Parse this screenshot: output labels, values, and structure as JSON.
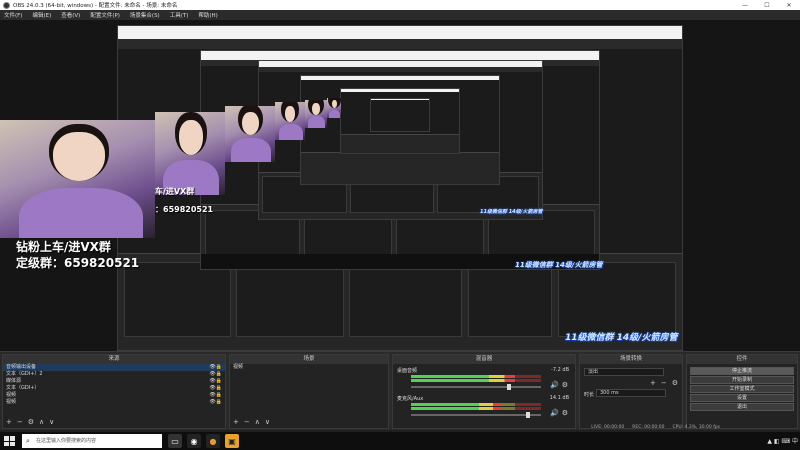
{
  "window": {
    "title": "OBS 24.0.3 (64-bit, windows) - 配置文件: 未命名 - 场景: 未命名",
    "minimize": "—",
    "maximize": "☐",
    "close": "✕"
  },
  "menu": [
    "文件(F)",
    "编辑(E)",
    "查看(V)",
    "配置文件(P)",
    "场景集合(S)",
    "工具(T)",
    "帮助(H)"
  ],
  "overlay": {
    "line1": "钻粉上车/进VX群",
    "line2": "定级群：659820521",
    "small_line1": "车/进VX群",
    "small_line2": "：659820521"
  },
  "banner": "11级微信群 14级/火箭房管",
  "docks": {
    "sources": {
      "title": "来源",
      "items": [
        {
          "label": "音频输出设备"
        },
        {
          "label": "文本（GDI+）2"
        },
        {
          "label": "媒体源"
        },
        {
          "label": "文本（GDI+）"
        },
        {
          "label": "视频"
        },
        {
          "label": "视频"
        }
      ]
    },
    "scenes": {
      "title": "场景",
      "items": [
        {
          "label": "视频"
        }
      ]
    },
    "mixer": {
      "title": "混音器",
      "channels": [
        {
          "name": "桌面音频",
          "db": "-7.2 dB",
          "level": 0.8,
          "volume": 0.75
        },
        {
          "name": "麦克风/Aux",
          "db": "14.1 dB",
          "level": 0.7,
          "volume": 0.9
        }
      ]
    },
    "transitions": {
      "title": "场景转换",
      "selected": "淡出",
      "duration_label": "时长",
      "duration": "300 ms"
    },
    "controls": {
      "title": "控件",
      "buttons": [
        "停止推流",
        "开始录制",
        "工作室模式",
        "设置",
        "退出"
      ]
    }
  },
  "status": {
    "live": "LIVE: 00:00:00",
    "rec": "REC: 00:00:00",
    "cpu": "CPU: 4.3%, 30.00 fps"
  },
  "taskbar": {
    "search_placeholder": "在这里输入你要搜索的内容",
    "tray_text": "▲  ◧  ⌨  中"
  },
  "colors": {
    "accent": "#2b6cff",
    "meter_green": "#55d055",
    "meter_yellow": "#e0d040",
    "meter_red": "#e04040"
  },
  "icons": {
    "add": "+",
    "remove": "−",
    "settings": "⚙",
    "up": "∧",
    "down": "∨",
    "speaker": "🔊",
    "eye": "👁",
    "lock": "🔒"
  }
}
